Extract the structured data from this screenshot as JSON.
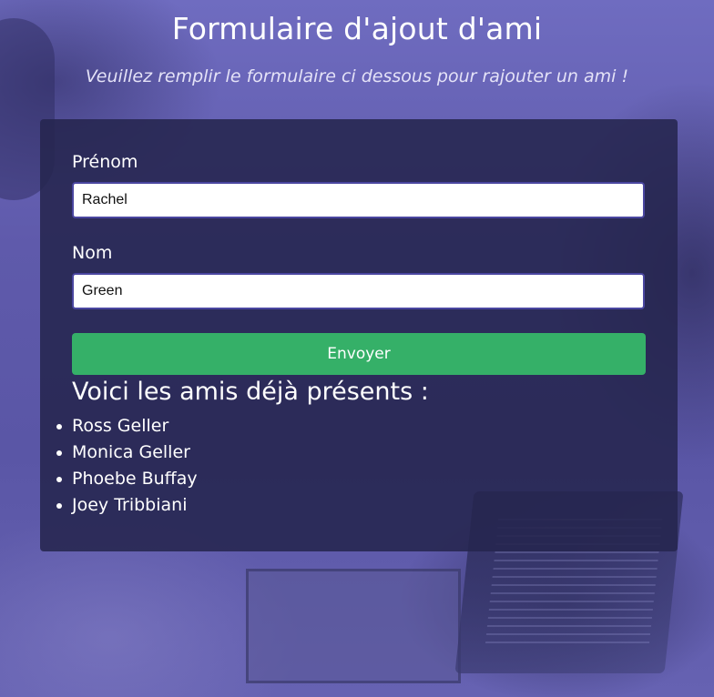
{
  "header": {
    "title": "Formulaire d'ajout d'ami",
    "subtitle": "Veuillez remplir le formulaire ci dessous pour rajouter un ami !"
  },
  "form": {
    "first_name": {
      "label": "Prénom",
      "value": "Rachel"
    },
    "last_name": {
      "label": "Nom",
      "value": "Green"
    },
    "submit_label": "Envoyer"
  },
  "friends": {
    "title": "Voici les amis déjà présents :",
    "items": [
      "Ross Geller",
      "Monica Geller",
      "Phoebe Buffay",
      "Joey Tribbiani"
    ]
  },
  "colors": {
    "background": "#5f5aab",
    "card": "#26254e",
    "button": "#35b068",
    "input_border": "#4a46a0"
  }
}
